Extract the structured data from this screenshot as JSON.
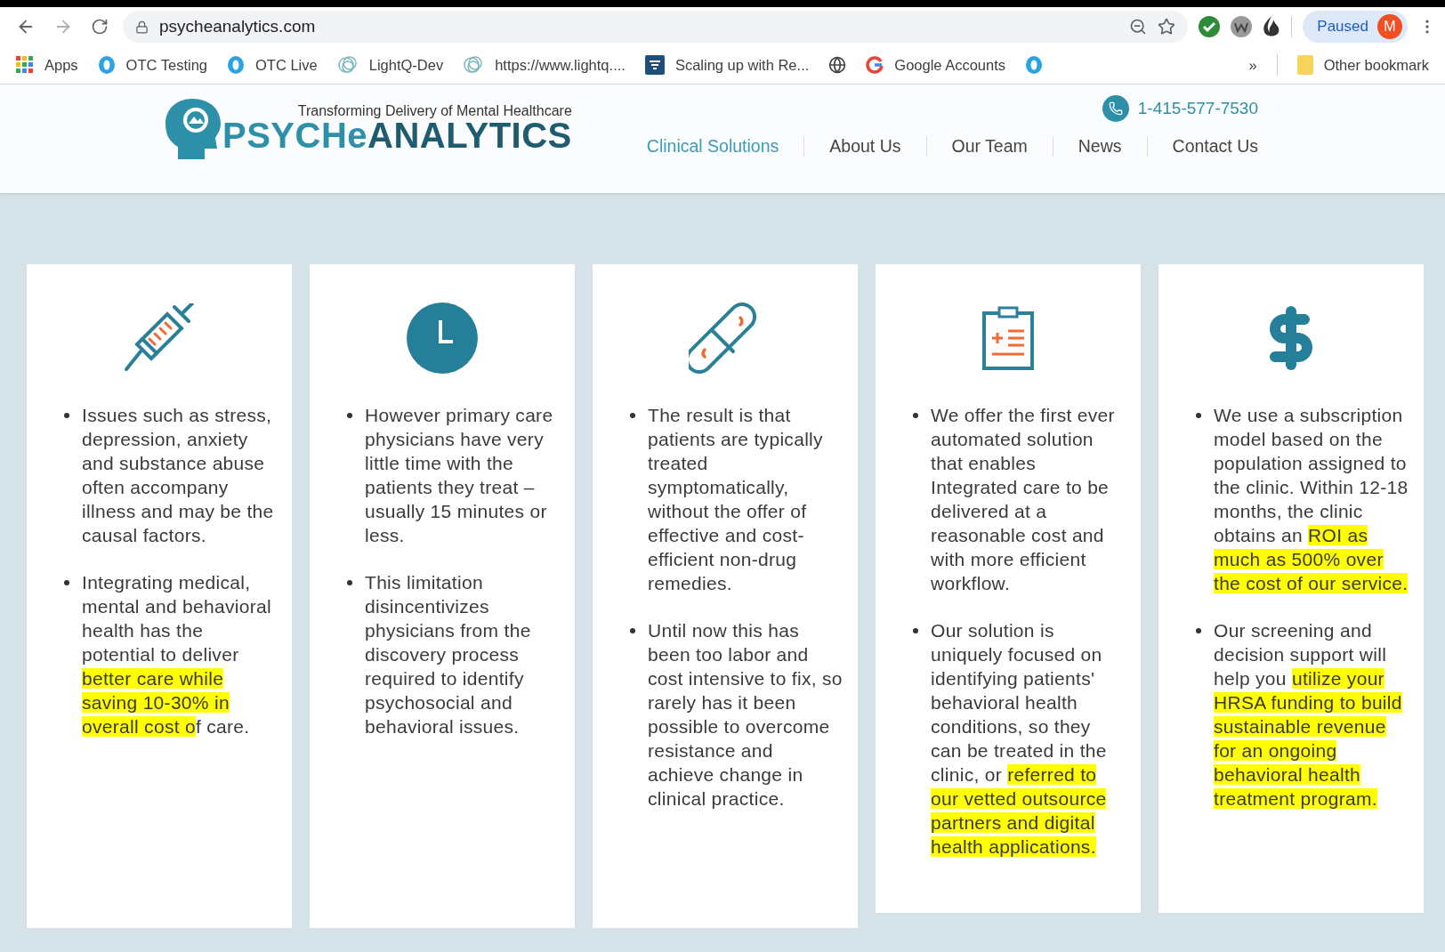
{
  "browser": {
    "url": "psycheanalytics.com",
    "profile": {
      "status": "Paused",
      "initial": "M"
    },
    "bookmarks": [
      {
        "label": "Apps"
      },
      {
        "label": "OTC Testing"
      },
      {
        "label": "OTC Live"
      },
      {
        "label": "LightQ-Dev"
      },
      {
        "label": "https://www.lightq...."
      },
      {
        "label": "Scaling up with Re..."
      },
      {
        "icon_only": true
      },
      {
        "label": "Google Accounts"
      },
      {
        "icon_only": true
      }
    ],
    "overflow": "»",
    "other_bookmarks": "Other bookmark"
  },
  "header": {
    "logo": {
      "tagline": "Transforming Delivery of Mental Healthcare",
      "parts": [
        {
          "text": "PSYCHe",
          "color": "#2e8fa9"
        },
        {
          "text": "ANALYTICS",
          "color": "#1f5c70"
        }
      ]
    },
    "phone": "1-415-577-7530",
    "nav": [
      {
        "label": "Clinical Solutions",
        "selected": true
      },
      {
        "label": "About Us",
        "selected": false
      },
      {
        "label": "Our Team",
        "selected": false
      },
      {
        "label": "News",
        "selected": false
      },
      {
        "label": "Contact Us",
        "selected": false
      }
    ]
  },
  "cards": [
    {
      "bullets": [
        [
          {
            "text": "Issues such as stress, depression, anxiety and substance abuse often accompany illness and may be the causal factors.",
            "highlight": false
          }
        ],
        [
          {
            "text": "Integrating medical, mental and behavioral health has the potential to deliver ",
            "highlight": false
          },
          {
            "text": "better care while saving 10-30% in overall cost o",
            "highlight": true
          },
          {
            "text": "f care.",
            "highlight": false
          }
        ]
      ]
    },
    {
      "bullets": [
        [
          {
            "text": "However primary care physicians have very little time with the patients they treat – usually 15 minutes or less.",
            "highlight": false
          }
        ],
        [
          {
            "text": "This limitation disincentivizes physicians from the discovery process required to identify psychosocial and behavioral issues.",
            "highlight": false
          }
        ]
      ]
    },
    {
      "bullets": [
        [
          {
            "text": "The result is that patients are typically treated symptomatically, without the offer of effective and cost-efficient non-drug remedies.",
            "highlight": false
          }
        ],
        [
          {
            "text": "Until now this has been too labor and cost intensive to fix, so rarely has it been possible to overcome resistance and achieve change in clinical practice.",
            "highlight": false
          }
        ]
      ]
    },
    {
      "bullets": [
        [
          {
            "text": "We offer the first ever automated solution that enables Integrated care to be delivered at a reasonable cost and with more efficient workflow.",
            "highlight": false
          }
        ],
        [
          {
            "text": "Our solution is uniquely focused on identifying patients' behavioral health conditions, so they can be treated in the clinic, or ",
            "highlight": false
          },
          {
            "text": "referred to our vetted outsource partners and digital health applications.",
            "highlight": true
          }
        ]
      ]
    },
    {
      "bullets": [
        [
          {
            "text": "We use a subscription model based on the population assigned to the clinic. Within 12-18 months, the clinic obtains an ",
            "highlight": false
          },
          {
            "text": "ROI as much as 500% over the cost of our service.",
            "highlight": true
          }
        ],
        [
          {
            "text": "Our screening and decision support will help you ",
            "highlight": false
          },
          {
            "text": "utilize your HRSA funding to build sustainable revenue for an ongoing behavioral health treatment program.",
            "highlight": true
          }
        ]
      ]
    }
  ]
}
